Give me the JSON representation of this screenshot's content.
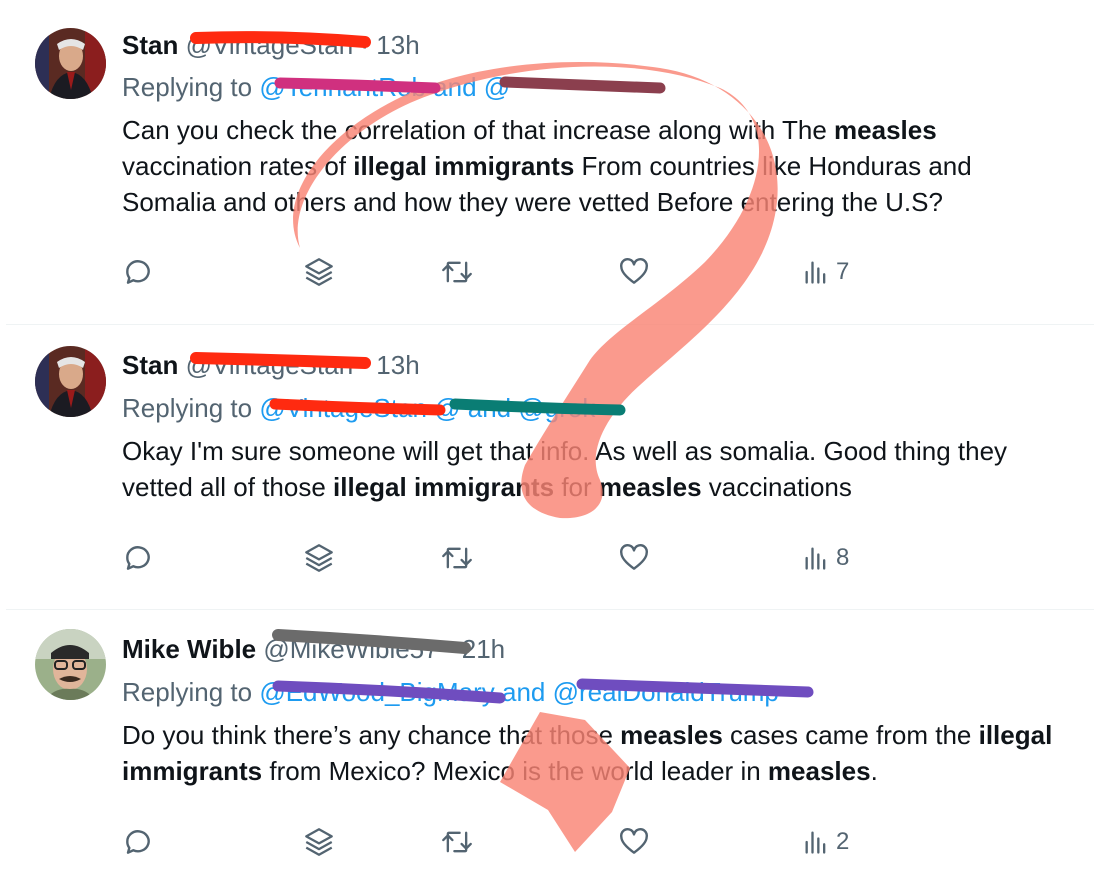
{
  "tweets": [
    {
      "display_name": "Stan",
      "handle": "@VintageStan",
      "time": "13h",
      "reply_prefix": "Replying to",
      "mentions": "@TennantRob and @",
      "body": [
        {
          "t": "Can you check the correlation of that increase along with The "
        },
        {
          "b": "measles"
        },
        {
          "t": " vaccination rates of "
        },
        {
          "b": "illegal immigrants"
        },
        {
          "t": " From countries like Honduras and Somalia and others  and how they were vetted Before entering the U.S?"
        }
      ],
      "views": "7"
    },
    {
      "display_name": "Stan",
      "handle": "@VintageStan",
      "time": "13h",
      "reply_prefix": "Replying to",
      "mentions": "@VintageStan @",
      "mentions_tail": "and @grok",
      "body": [
        {
          "t": "Okay I'm sure someone will get that info. As well as somalia. Good thing they vetted all of those "
        },
        {
          "b": "illegal immigrants"
        },
        {
          "t": " for "
        },
        {
          "b": "measles"
        },
        {
          "t": " vaccinations"
        }
      ],
      "views": "8"
    },
    {
      "display_name": "Mike Wible",
      "handle": "@MikeWible57",
      "time": "21h",
      "reply_prefix": "Replying to",
      "mentions": "@EdWood_BigMary and @realDonaldTrump",
      "body": [
        {
          "t": "Do you think there’s any chance that those "
        },
        {
          "b": "measles"
        },
        {
          "t": " cases came from the "
        },
        {
          "b": "illegal immigrants"
        },
        {
          "t": " from Mexico? Mexico is the world leader in "
        },
        {
          "b": "measles"
        },
        {
          "t": "."
        }
      ],
      "views": "2"
    }
  ],
  "icons": {
    "reply": "reply-icon",
    "grok": "grok-stack-icon",
    "retweet": "retweet-icon",
    "like": "heart-icon",
    "views": "views-bar-chart-icon"
  },
  "colors": {
    "text": "#0f1419",
    "muted": "#536471",
    "link": "#1d9bf0",
    "scribble_red": "#ff2a10",
    "scribble_magenta": "#d0307f",
    "scribble_maroon": "#8b3f4e",
    "scribble_teal": "#0a7d74",
    "scribble_purple": "#6f4dbf",
    "scribble_gray": "#6b6b6b",
    "question_mark_fill": "#f98474"
  }
}
